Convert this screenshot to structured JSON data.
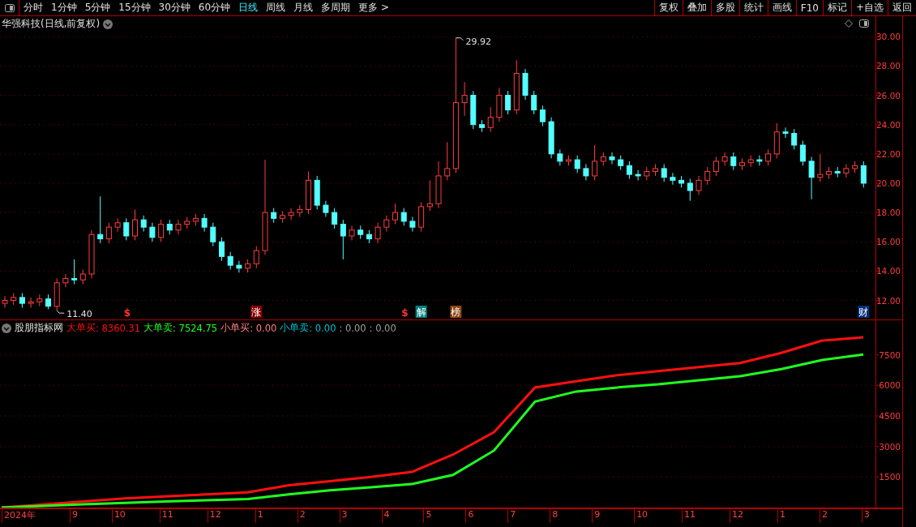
{
  "toolbar": {
    "periods": [
      {
        "label": "分时",
        "selected": false
      },
      {
        "label": "1分钟",
        "selected": false
      },
      {
        "label": "5分钟",
        "selected": false
      },
      {
        "label": "15分钟",
        "selected": false
      },
      {
        "label": "30分钟",
        "selected": false
      },
      {
        "label": "60分钟",
        "selected": false
      },
      {
        "label": "日线",
        "selected": true
      },
      {
        "label": "周线",
        "selected": false
      },
      {
        "label": "月线",
        "selected": false
      },
      {
        "label": "多周期",
        "selected": false
      },
      {
        "label": "更多 >",
        "selected": false
      }
    ],
    "actions": [
      "复权",
      "叠加",
      "多股",
      "统计",
      "画线",
      "F10",
      "标记",
      "+自选",
      "返回"
    ]
  },
  "price_panel": {
    "title": "华强科技(日线,前复权)",
    "chart_data": {
      "type": "candlestick",
      "ylim": [
        10.7,
        31.4
      ],
      "yticks": [
        {
          "value": 12,
          "label": "12.00"
        },
        {
          "value": 14,
          "label": "14.00"
        },
        {
          "value": 16,
          "label": "16.00"
        },
        {
          "value": 18,
          "label": "18.00"
        },
        {
          "value": 20,
          "label": "20.00"
        },
        {
          "value": 22,
          "label": "22.00"
        },
        {
          "value": 24,
          "label": "24.00"
        },
        {
          "value": 26,
          "label": "26.00"
        },
        {
          "value": 28,
          "label": "28.00"
        },
        {
          "value": 30,
          "label": "30.00"
        }
      ],
      "grid": true,
      "ohlc": [
        [
          11.8,
          12.3,
          11.5,
          12
        ],
        [
          12,
          12.5,
          11.7,
          12.2
        ],
        [
          12.2,
          12.5,
          11.5,
          11.8
        ],
        [
          11.8,
          12.2,
          11.5,
          11.9
        ],
        [
          11.9,
          12.4,
          11.6,
          12.1
        ],
        [
          12.1,
          12.4,
          11.4,
          11.6
        ],
        [
          11.6,
          13.5,
          11.3,
          13.2
        ],
        [
          13.2,
          13.8,
          12.9,
          13.5
        ],
        [
          13.5,
          14.8,
          13.1,
          13.4
        ],
        [
          13.4,
          14.1,
          13.1,
          13.8
        ],
        [
          13.8,
          16.8,
          13.5,
          16.5
        ],
        [
          16.5,
          19.1,
          15.9,
          16.2
        ],
        [
          16.2,
          17.3,
          15.9,
          17
        ],
        [
          17,
          17.6,
          16.7,
          17.3
        ],
        [
          17.3,
          17.6,
          16.1,
          16.4
        ],
        [
          16.4,
          18.2,
          16.1,
          17.5
        ],
        [
          17.5,
          17.8,
          16.7,
          17
        ],
        [
          17,
          17.3,
          16,
          16.3
        ],
        [
          16.3,
          17.5,
          16,
          17.2
        ],
        [
          17.2,
          17.5,
          16.5,
          16.8
        ],
        [
          16.8,
          17.5,
          16.5,
          17.2
        ],
        [
          17.2,
          17.7,
          16.9,
          17.4
        ],
        [
          17.4,
          17.9,
          17.1,
          17.6
        ],
        [
          17.6,
          17.9,
          16.7,
          17
        ],
        [
          17,
          17.3,
          15.7,
          16
        ],
        [
          16,
          16.3,
          14.7,
          15
        ],
        [
          15,
          15.3,
          14.1,
          14.4
        ],
        [
          14.4,
          14.7,
          13.9,
          14.2
        ],
        [
          14.2,
          14.8,
          13.9,
          14.5
        ],
        [
          14.5,
          15.7,
          14.2,
          15.4
        ],
        [
          15.4,
          21.6,
          15.1,
          18
        ],
        [
          18,
          18.3,
          17.3,
          17.6
        ],
        [
          17.6,
          18.1,
          17.3,
          17.8
        ],
        [
          17.8,
          18.3,
          17.5,
          18
        ],
        [
          18,
          18.5,
          17.7,
          18.2
        ],
        [
          18.2,
          20.8,
          17.9,
          20.2
        ],
        [
          20.2,
          20.5,
          18.2,
          18.5
        ],
        [
          18.5,
          18.8,
          17.7,
          18
        ],
        [
          18,
          18.3,
          16.9,
          17.2
        ],
        [
          17.2,
          17.5,
          14.8,
          16.4
        ],
        [
          16.4,
          17.1,
          16.1,
          16.8
        ],
        [
          16.8,
          17.1,
          16.2,
          16.5
        ],
        [
          16.5,
          16.8,
          15.9,
          16.2
        ],
        [
          16.2,
          17.3,
          15.9,
          17
        ],
        [
          17,
          17.8,
          16.7,
          17.5
        ],
        [
          17.5,
          18.6,
          17.2,
          18
        ],
        [
          18,
          18.3,
          17.1,
          17.4
        ],
        [
          17.4,
          17.7,
          16.7,
          17
        ],
        [
          17,
          18.7,
          16.7,
          18.4
        ],
        [
          18.4,
          20.2,
          18.1,
          18.6
        ],
        [
          18.6,
          21.5,
          18.3,
          20.5
        ],
        [
          20.5,
          22.8,
          20.2,
          21
        ],
        [
          21,
          29.92,
          20.7,
          25.5
        ],
        [
          25.5,
          26.9,
          24.6,
          26
        ],
        [
          26,
          26.3,
          23.7,
          24
        ],
        [
          24,
          24.3,
          23.5,
          23.8
        ],
        [
          23.8,
          25.2,
          23.5,
          24.5
        ],
        [
          24.5,
          26.5,
          24.2,
          26
        ],
        [
          26,
          26.3,
          24.7,
          25
        ],
        [
          25,
          28.4,
          24.7,
          27.5
        ],
        [
          27.5,
          27.8,
          25.7,
          26
        ],
        [
          26,
          26.3,
          24.7,
          25
        ],
        [
          25,
          25.3,
          23.9,
          24.2
        ],
        [
          24.2,
          24.5,
          21.7,
          22
        ],
        [
          22,
          22.3,
          21.2,
          21.5
        ],
        [
          21.5,
          21.9,
          21.2,
          21.6
        ],
        [
          21.6,
          21.9,
          20.7,
          21
        ],
        [
          21,
          21.3,
          20.2,
          20.5
        ],
        [
          20.5,
          22.6,
          20.2,
          21.5
        ],
        [
          21.5,
          22.1,
          21.2,
          21.8
        ],
        [
          21.8,
          22.1,
          21.3,
          21.6
        ],
        [
          21.6,
          21.9,
          20.9,
          21.2
        ],
        [
          21.2,
          21.5,
          20.3,
          20.6
        ],
        [
          20.6,
          20.9,
          20.2,
          20.5
        ],
        [
          20.5,
          21.1,
          20.2,
          20.8
        ],
        [
          20.8,
          21.3,
          20.5,
          21
        ],
        [
          21,
          21.3,
          20.1,
          20.4
        ],
        [
          20.4,
          20.7,
          19.9,
          20.2
        ],
        [
          20.2,
          20.5,
          19.7,
          20
        ],
        [
          20,
          20.3,
          18.8,
          19.5
        ],
        [
          19.5,
          20.5,
          19.2,
          20.2
        ],
        [
          20.2,
          21.1,
          19.9,
          20.8
        ],
        [
          20.8,
          21.8,
          20.5,
          21.5
        ],
        [
          21.5,
          22.1,
          21.2,
          21.8
        ],
        [
          21.8,
          22.1,
          20.9,
          21.2
        ],
        [
          21.2,
          21.7,
          20.9,
          21.4
        ],
        [
          21.4,
          21.9,
          21.1,
          21.6
        ],
        [
          21.6,
          21.9,
          21.2,
          21.5
        ],
        [
          21.5,
          22.3,
          21.2,
          22
        ],
        [
          22,
          24.1,
          21.7,
          23.5
        ],
        [
          23.5,
          23.8,
          23.1,
          23.4
        ],
        [
          23.4,
          23.7,
          22.3,
          22.6
        ],
        [
          22.6,
          22.9,
          21.2,
          21.5
        ],
        [
          21.5,
          21.8,
          18.9,
          20.4
        ],
        [
          20.4,
          22,
          20.1,
          20.6
        ],
        [
          20.6,
          21.1,
          20.3,
          20.8
        ],
        [
          20.8,
          21.1,
          20.4,
          20.7
        ],
        [
          20.7,
          21.3,
          20.4,
          21
        ],
        [
          21,
          21.5,
          20.7,
          21.2
        ],
        [
          21.2,
          21.5,
          19.7,
          20
        ]
      ],
      "annotations": [
        "29.92",
        "11.40"
      ]
    },
    "event_marks": [
      {
        "label": "$",
        "kind": "text",
        "color": "#ff3030"
      },
      {
        "label": "涨",
        "kind": "tag",
        "color": "#8b0000"
      },
      {
        "label": "$",
        "kind": "text",
        "color": "#ff3030"
      },
      {
        "label": "解",
        "kind": "tag",
        "color": "#008080"
      },
      {
        "label": "榜",
        "kind": "tag",
        "color": "#8b4513"
      },
      {
        "label": "财",
        "kind": "tag",
        "color": "#00307a"
      }
    ]
  },
  "indicator_panel": {
    "name": "股朋指标网",
    "readings": [
      {
        "value": ": 8360.31"
      },
      {
        "value": ": 7524.75"
      },
      {
        "label": "小单买",
        "value": ": 0.00",
        "color": "#ff8080"
      },
      {
        "label": "小单卖",
        "value": ": 0.00",
        "color": "#00c0d0"
      },
      {
        "value": ": 0.00",
        "color": "#a0a0a0"
      },
      {
        "value": ": 0.00",
        "color": "#a0a0a0"
      }
    ],
    "chart_data": {
      "type": "line",
      "grid": true,
      "ylim": [
        0,
        9200
      ],
      "yticks": [
        1500,
        3000,
        4500,
        6000,
        7500
      ],
      "series": [
        {
          "name": "大单买",
          "color": "#ff1010",
          "values": [
            0,
            150,
            300,
            450,
            550,
            650,
            750,
            1100,
            1300,
            1500,
            1750,
            2600,
            3700,
            5900,
            6200,
            6500,
            6700,
            6900,
            7100,
            7600,
            8200,
            8360
          ]
        },
        {
          "name": "大单卖",
          "color": "#20ff20",
          "values": [
            0,
            80,
            160,
            230,
            300,
            360,
            420,
            650,
            850,
            1000,
            1150,
            1600,
            2800,
            5200,
            5700,
            5900,
            6050,
            6250,
            6450,
            6800,
            7250,
            7520
          ]
        }
      ]
    }
  },
  "date_axis": [
    "2024年",
    "9",
    "10",
    "11",
    "12",
    "1",
    "2",
    "3",
    "4",
    "5",
    "6",
    "7",
    "8",
    "9",
    "10",
    "11",
    "12",
    "1",
    "2",
    "3"
  ]
}
